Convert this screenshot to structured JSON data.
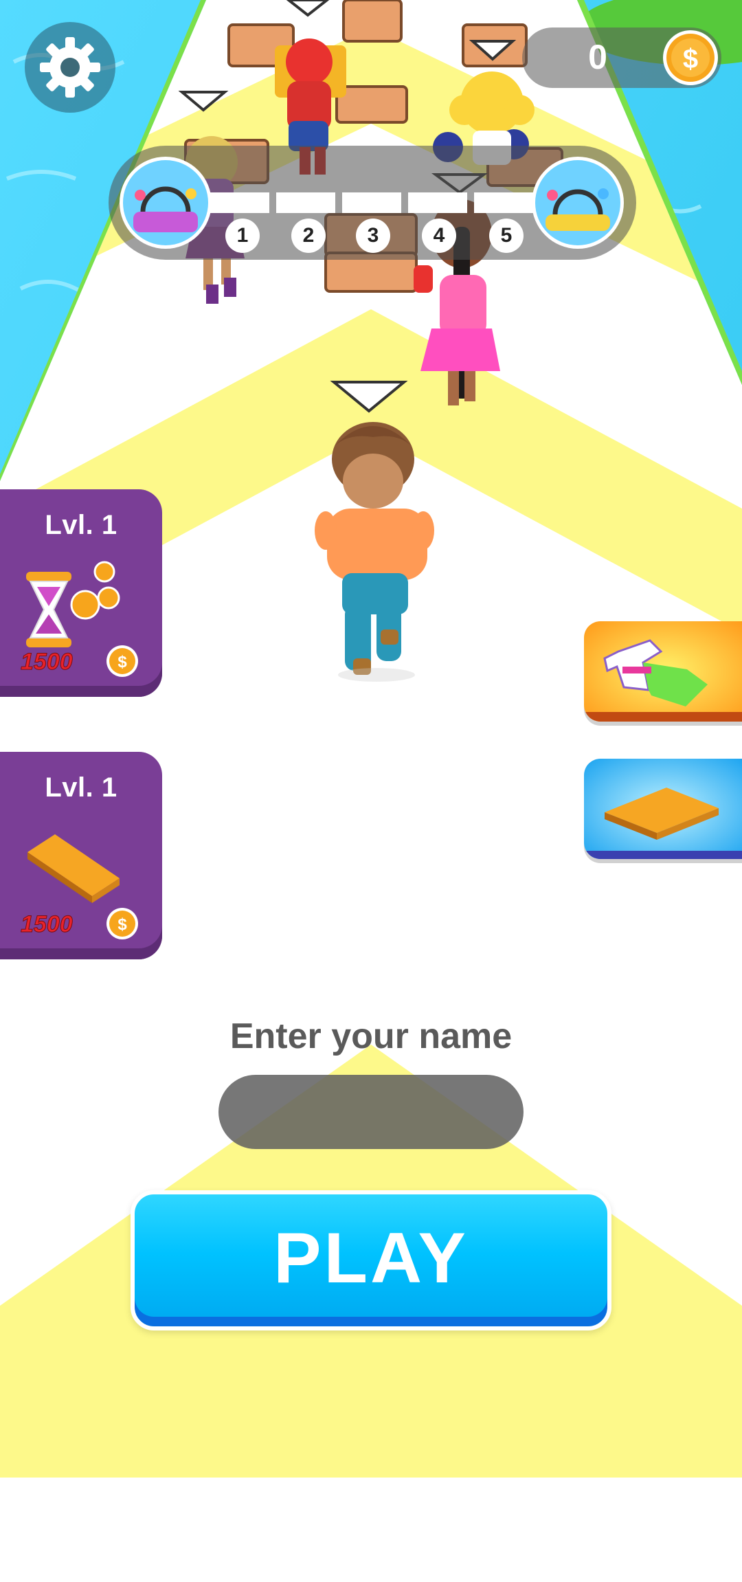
{
  "scene": {
    "sky_water_color": "#3fd0f5",
    "track_stripe_colors": [
      "#ffffff",
      "#fdf98a"
    ],
    "player_shirt_color": "#ff9a55",
    "player_pants_color": "#2a98b8"
  },
  "top_bar": {
    "settings_icon": "gear-icon",
    "coins": "0",
    "coin_icon": "coin-icon",
    "coin_symbol": "$"
  },
  "level_progress": {
    "stages": [
      "1",
      "2",
      "3",
      "4",
      "5"
    ],
    "start_icon": "start-island-thumbnail",
    "end_icon": "finish-island-thumbnail"
  },
  "upgrades": [
    {
      "level_label": "Lvl. 1",
      "icon": "hourglass-coins-icon",
      "price": "1500",
      "price_icon": "coin-icon"
    },
    {
      "level_label": "Lvl. 1",
      "icon": "plank-icon",
      "price": "1500",
      "price_icon": "coin-icon"
    }
  ],
  "side_buttons": [
    {
      "icon": "shirt-icon",
      "background": "#ffb21e"
    },
    {
      "icon": "plank-icon",
      "background": "#27aef5"
    }
  ],
  "name_entry": {
    "label": "Enter your name",
    "value": ""
  },
  "play_button": {
    "label": "PLAY"
  },
  "colors": {
    "card_purple": "#7a3e96",
    "play_blue": "#00c2ff",
    "coin_gold": "#f7a51c"
  }
}
